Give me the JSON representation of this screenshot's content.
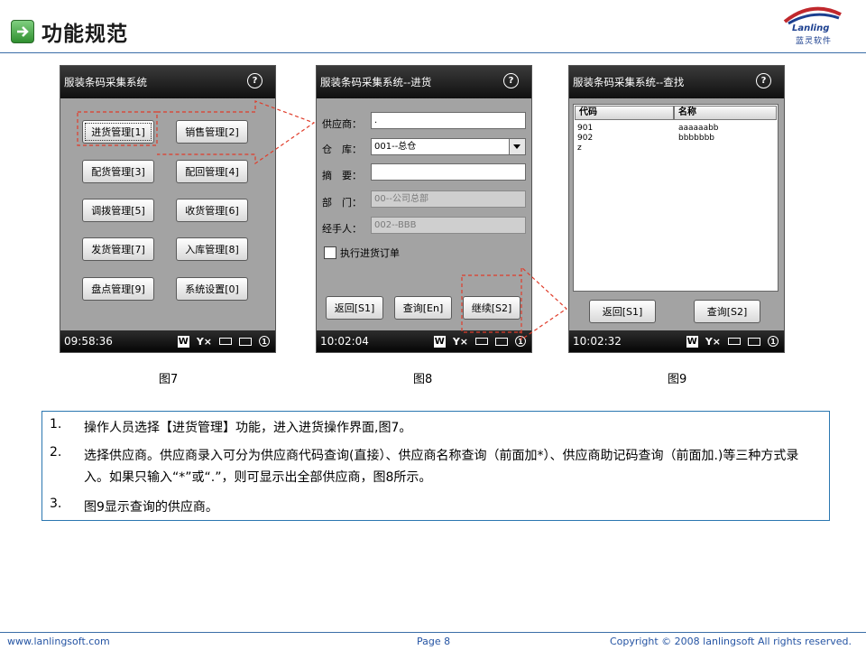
{
  "header": {
    "title": "功能规范"
  },
  "logo": {
    "text": "Lanling",
    "cn": "蓝灵软件"
  },
  "screen1": {
    "title": "服装条码采集系统",
    "help": "?",
    "buttons": [
      "进货管理[1]",
      "销售管理[2]",
      "配货管理[3]",
      "配回管理[4]",
      "调拨管理[5]",
      "收货管理[6]",
      "发货管理[7]",
      "入库管理[8]",
      "盘点管理[9]",
      "系统设置[0]"
    ],
    "time": "09:58:36"
  },
  "screen2": {
    "title": "服装条码采集系统--进货",
    "help": "?",
    "labels": {
      "supplier": "供应商：",
      "warehouse": "仓　库：",
      "summary": "摘　要：",
      "dept": "部　门：",
      "handler": "经手人："
    },
    "values": {
      "supplier": ".",
      "warehouse": "001--总仓",
      "summary": "",
      "dept": "00--公司总部",
      "handler": "002--BBB"
    },
    "checkbox": "执行进货订单",
    "buttons": {
      "back": "返回[S1]",
      "query": "查询[En]",
      "next": "继续[S2]"
    },
    "time": "10:02:04"
  },
  "screen3": {
    "title": "服装条码采集系统--查找",
    "help": "?",
    "columns": [
      "代码",
      "名称"
    ],
    "rows": [
      {
        "code": "901",
        "name": "aaaaaabb"
      },
      {
        "code": "902",
        "name": "bbbbbbb"
      },
      {
        "code": "z",
        "name": ""
      }
    ],
    "buttons": {
      "back": "返回[S1]",
      "query": "查询[S2]"
    },
    "time": "10:02:32"
  },
  "status_icons": {
    "w": "W",
    "signal": "Y×",
    "one": "1"
  },
  "captions": [
    "图7",
    "图8",
    "图9"
  ],
  "notes": [
    {
      "num": "1.",
      "text": "操作人员选择【进货管理】功能，进入进货操作界面,图7。"
    },
    {
      "num": "2.",
      "text": "选择供应商。供应商录入可分为供应商代码查询(直接）、供应商名称查询（前面加*）、供应商助记码查询（前面加.)等三种方式录入。如果只输入“*”或“.”，则可显示出全部供应商，图8所示。"
    },
    {
      "num": "3.",
      "text": "图9显示查询的供应商。"
    }
  ],
  "footer": {
    "website": "www.lanlingsoft.com",
    "page": "Page 8",
    "copyright": "Copyright © 2008 lanlingsoft All rights reserved."
  },
  "colors": {
    "rule": "#3b6ea8",
    "notes_border": "#2b77b0",
    "callout": "#e03c2a",
    "screen_bg": "#a3a3a3"
  }
}
